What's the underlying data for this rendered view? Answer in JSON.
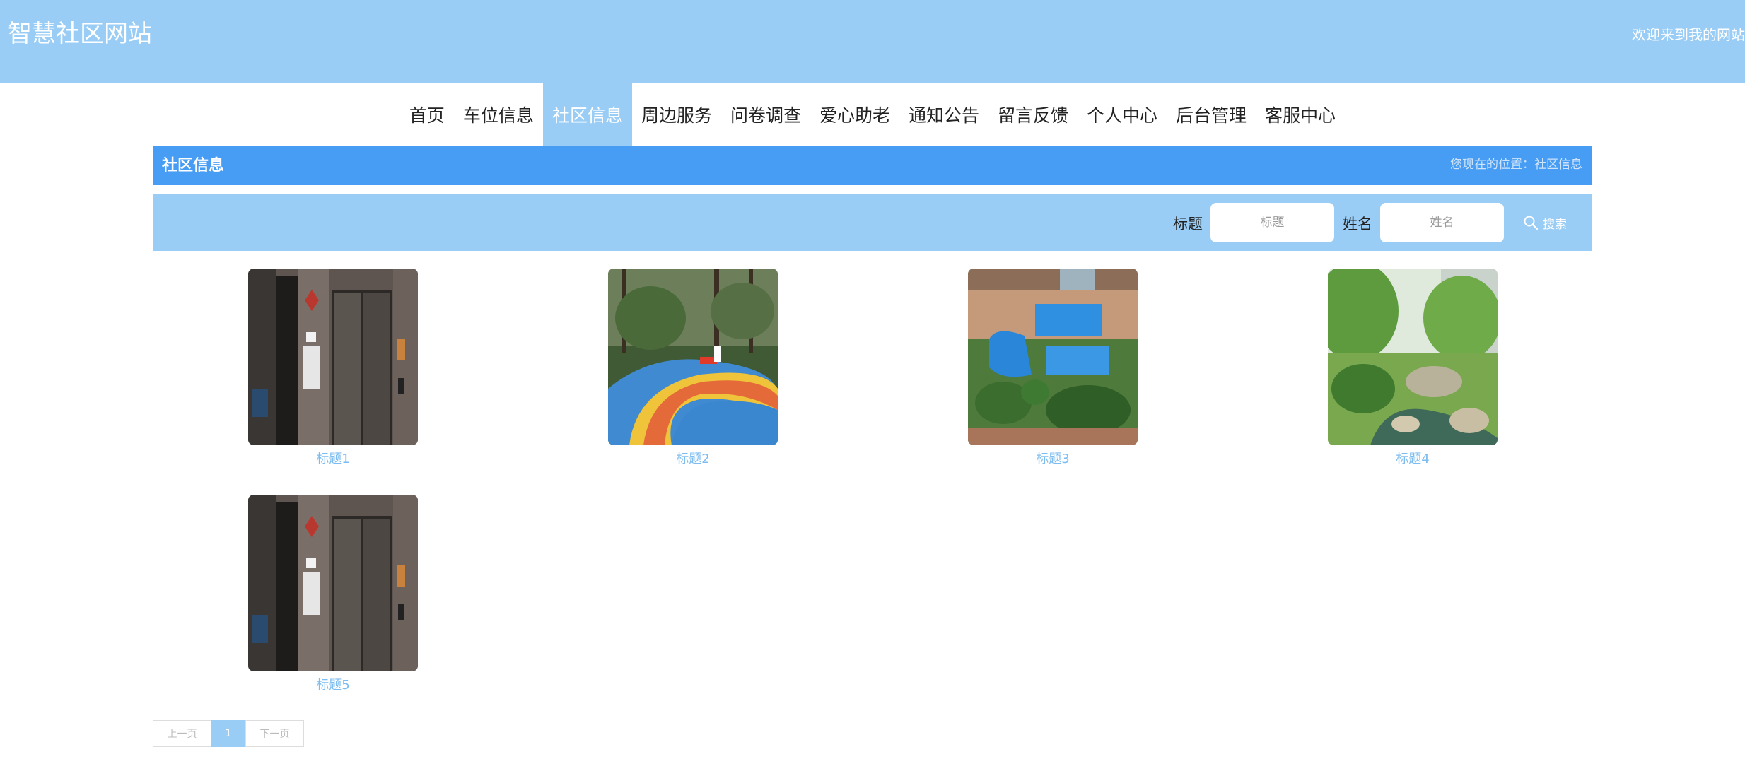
{
  "header": {
    "site_title": "智慧社区网站",
    "welcome": "欢迎来到我的网站"
  },
  "nav": {
    "items": [
      {
        "label": "首页",
        "active": false
      },
      {
        "label": "车位信息",
        "active": false
      },
      {
        "label": "社区信息",
        "active": true
      },
      {
        "label": "周边服务",
        "active": false
      },
      {
        "label": "问卷调查",
        "active": false
      },
      {
        "label": "爱心助老",
        "active": false
      },
      {
        "label": "通知公告",
        "active": false
      },
      {
        "label": "留言反馈",
        "active": false
      },
      {
        "label": "个人中心",
        "active": false
      },
      {
        "label": "后台管理",
        "active": false
      },
      {
        "label": "客服中心",
        "active": false
      }
    ]
  },
  "section": {
    "title": "社区信息",
    "breadcrumb": "您现在的位置：社区信息"
  },
  "search": {
    "title_label": "标题",
    "title_placeholder": "标题",
    "name_label": "姓名",
    "name_placeholder": "姓名",
    "button_label": "搜索"
  },
  "items": [
    {
      "title": "标题1",
      "image": "elevator-lobby"
    },
    {
      "title": "标题2",
      "image": "playground"
    },
    {
      "title": "标题3",
      "image": "swimming-pool"
    },
    {
      "title": "标题4",
      "image": "garden-pond"
    },
    {
      "title": "标题5",
      "image": "elevator-lobby"
    }
  ],
  "pagination": {
    "prev_label": "上一页",
    "current_page": "1",
    "next_label": "下一页"
  },
  "colors": {
    "header_bg": "#99cdf5",
    "section_bar_bg": "#479cf3",
    "link_text": "#7cbcf0"
  }
}
